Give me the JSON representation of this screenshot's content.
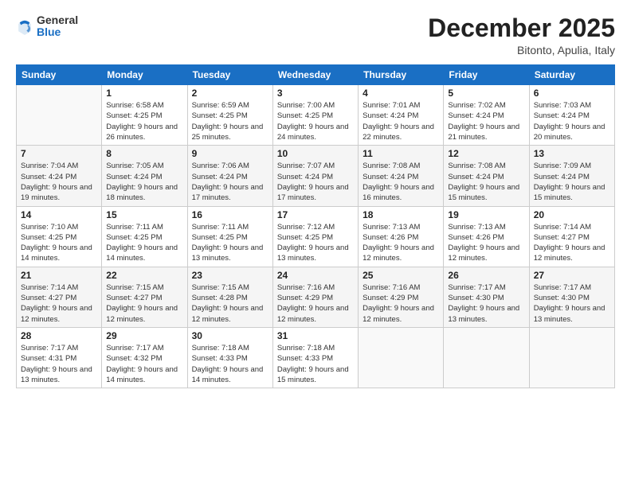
{
  "header": {
    "logo_general": "General",
    "logo_blue": "Blue",
    "title": "December 2025",
    "location": "Bitonto, Apulia, Italy"
  },
  "weekdays": [
    "Sunday",
    "Monday",
    "Tuesday",
    "Wednesday",
    "Thursday",
    "Friday",
    "Saturday"
  ],
  "weeks": [
    [
      {
        "day": "",
        "sunrise": "",
        "sunset": "",
        "daylight": ""
      },
      {
        "day": "1",
        "sunrise": "Sunrise: 6:58 AM",
        "sunset": "Sunset: 4:25 PM",
        "daylight": "Daylight: 9 hours and 26 minutes."
      },
      {
        "day": "2",
        "sunrise": "Sunrise: 6:59 AM",
        "sunset": "Sunset: 4:25 PM",
        "daylight": "Daylight: 9 hours and 25 minutes."
      },
      {
        "day": "3",
        "sunrise": "Sunrise: 7:00 AM",
        "sunset": "Sunset: 4:25 PM",
        "daylight": "Daylight: 9 hours and 24 minutes."
      },
      {
        "day": "4",
        "sunrise": "Sunrise: 7:01 AM",
        "sunset": "Sunset: 4:24 PM",
        "daylight": "Daylight: 9 hours and 22 minutes."
      },
      {
        "day": "5",
        "sunrise": "Sunrise: 7:02 AM",
        "sunset": "Sunset: 4:24 PM",
        "daylight": "Daylight: 9 hours and 21 minutes."
      },
      {
        "day": "6",
        "sunrise": "Sunrise: 7:03 AM",
        "sunset": "Sunset: 4:24 PM",
        "daylight": "Daylight: 9 hours and 20 minutes."
      }
    ],
    [
      {
        "day": "7",
        "sunrise": "Sunrise: 7:04 AM",
        "sunset": "Sunset: 4:24 PM",
        "daylight": "Daylight: 9 hours and 19 minutes."
      },
      {
        "day": "8",
        "sunrise": "Sunrise: 7:05 AM",
        "sunset": "Sunset: 4:24 PM",
        "daylight": "Daylight: 9 hours and 18 minutes."
      },
      {
        "day": "9",
        "sunrise": "Sunrise: 7:06 AM",
        "sunset": "Sunset: 4:24 PM",
        "daylight": "Daylight: 9 hours and 17 minutes."
      },
      {
        "day": "10",
        "sunrise": "Sunrise: 7:07 AM",
        "sunset": "Sunset: 4:24 PM",
        "daylight": "Daylight: 9 hours and 17 minutes."
      },
      {
        "day": "11",
        "sunrise": "Sunrise: 7:08 AM",
        "sunset": "Sunset: 4:24 PM",
        "daylight": "Daylight: 9 hours and 16 minutes."
      },
      {
        "day": "12",
        "sunrise": "Sunrise: 7:08 AM",
        "sunset": "Sunset: 4:24 PM",
        "daylight": "Daylight: 9 hours and 15 minutes."
      },
      {
        "day": "13",
        "sunrise": "Sunrise: 7:09 AM",
        "sunset": "Sunset: 4:24 PM",
        "daylight": "Daylight: 9 hours and 15 minutes."
      }
    ],
    [
      {
        "day": "14",
        "sunrise": "Sunrise: 7:10 AM",
        "sunset": "Sunset: 4:25 PM",
        "daylight": "Daylight: 9 hours and 14 minutes."
      },
      {
        "day": "15",
        "sunrise": "Sunrise: 7:11 AM",
        "sunset": "Sunset: 4:25 PM",
        "daylight": "Daylight: 9 hours and 14 minutes."
      },
      {
        "day": "16",
        "sunrise": "Sunrise: 7:11 AM",
        "sunset": "Sunset: 4:25 PM",
        "daylight": "Daylight: 9 hours and 13 minutes."
      },
      {
        "day": "17",
        "sunrise": "Sunrise: 7:12 AM",
        "sunset": "Sunset: 4:25 PM",
        "daylight": "Daylight: 9 hours and 13 minutes."
      },
      {
        "day": "18",
        "sunrise": "Sunrise: 7:13 AM",
        "sunset": "Sunset: 4:26 PM",
        "daylight": "Daylight: 9 hours and 12 minutes."
      },
      {
        "day": "19",
        "sunrise": "Sunrise: 7:13 AM",
        "sunset": "Sunset: 4:26 PM",
        "daylight": "Daylight: 9 hours and 12 minutes."
      },
      {
        "day": "20",
        "sunrise": "Sunrise: 7:14 AM",
        "sunset": "Sunset: 4:27 PM",
        "daylight": "Daylight: 9 hours and 12 minutes."
      }
    ],
    [
      {
        "day": "21",
        "sunrise": "Sunrise: 7:14 AM",
        "sunset": "Sunset: 4:27 PM",
        "daylight": "Daylight: 9 hours and 12 minutes."
      },
      {
        "day": "22",
        "sunrise": "Sunrise: 7:15 AM",
        "sunset": "Sunset: 4:27 PM",
        "daylight": "Daylight: 9 hours and 12 minutes."
      },
      {
        "day": "23",
        "sunrise": "Sunrise: 7:15 AM",
        "sunset": "Sunset: 4:28 PM",
        "daylight": "Daylight: 9 hours and 12 minutes."
      },
      {
        "day": "24",
        "sunrise": "Sunrise: 7:16 AM",
        "sunset": "Sunset: 4:29 PM",
        "daylight": "Daylight: 9 hours and 12 minutes."
      },
      {
        "day": "25",
        "sunrise": "Sunrise: 7:16 AM",
        "sunset": "Sunset: 4:29 PM",
        "daylight": "Daylight: 9 hours and 12 minutes."
      },
      {
        "day": "26",
        "sunrise": "Sunrise: 7:17 AM",
        "sunset": "Sunset: 4:30 PM",
        "daylight": "Daylight: 9 hours and 13 minutes."
      },
      {
        "day": "27",
        "sunrise": "Sunrise: 7:17 AM",
        "sunset": "Sunset: 4:30 PM",
        "daylight": "Daylight: 9 hours and 13 minutes."
      }
    ],
    [
      {
        "day": "28",
        "sunrise": "Sunrise: 7:17 AM",
        "sunset": "Sunset: 4:31 PM",
        "daylight": "Daylight: 9 hours and 13 minutes."
      },
      {
        "day": "29",
        "sunrise": "Sunrise: 7:17 AM",
        "sunset": "Sunset: 4:32 PM",
        "daylight": "Daylight: 9 hours and 14 minutes."
      },
      {
        "day": "30",
        "sunrise": "Sunrise: 7:18 AM",
        "sunset": "Sunset: 4:33 PM",
        "daylight": "Daylight: 9 hours and 14 minutes."
      },
      {
        "day": "31",
        "sunrise": "Sunrise: 7:18 AM",
        "sunset": "Sunset: 4:33 PM",
        "daylight": "Daylight: 9 hours and 15 minutes."
      },
      {
        "day": "",
        "sunrise": "",
        "sunset": "",
        "daylight": ""
      },
      {
        "day": "",
        "sunrise": "",
        "sunset": "",
        "daylight": ""
      },
      {
        "day": "",
        "sunrise": "",
        "sunset": "",
        "daylight": ""
      }
    ]
  ]
}
